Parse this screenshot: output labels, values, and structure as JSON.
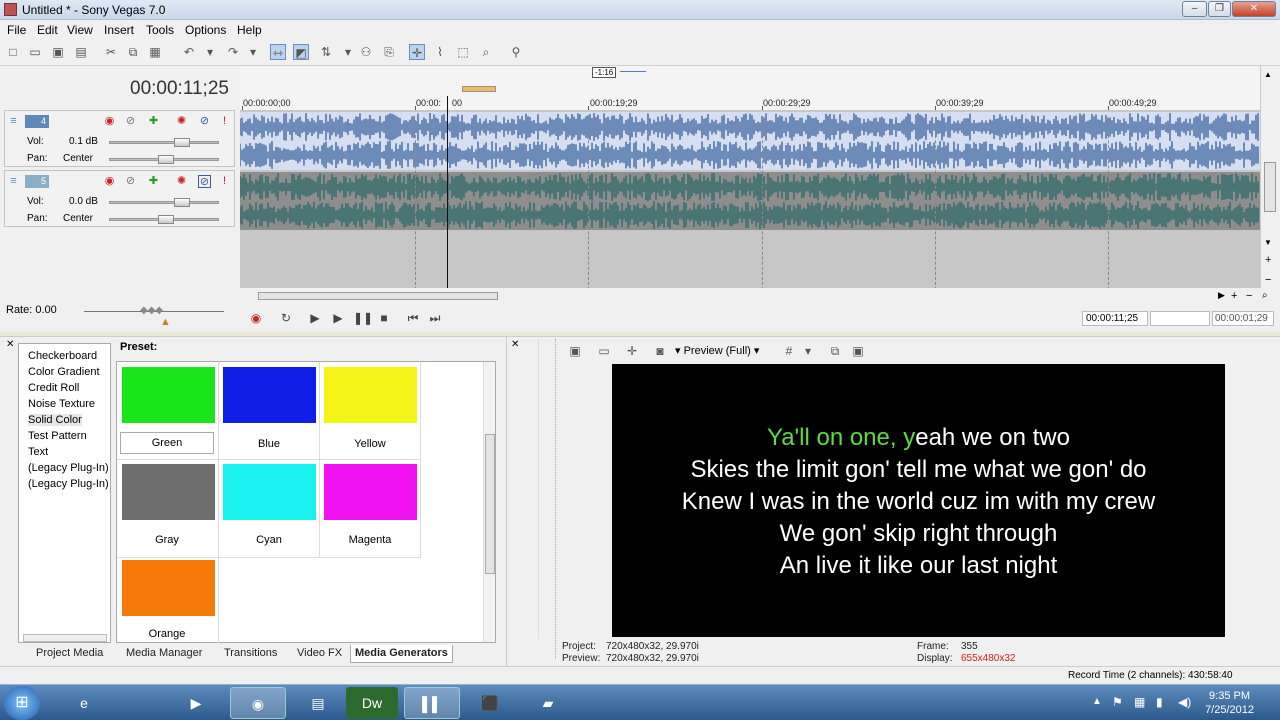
{
  "window": {
    "title": "Untitled * - Sony Vegas 7.0"
  },
  "menu": [
    "File",
    "Edit",
    "View",
    "Insert",
    "Tools",
    "Options",
    "Help"
  ],
  "timeline": {
    "cursor_time": "00:00:11;25",
    "loop_marker": "-1:16",
    "ruler_labels": [
      "00:00:00;00",
      "00:00:",
      "00",
      "00:00:19;29",
      "00:00:29;29",
      "00:00:39;29",
      "00:00:49;29"
    ],
    "tracks": [
      {
        "number": "4",
        "vol_label": "Vol:",
        "vol": "0.1 dB",
        "pan_label": "Pan:",
        "pan": "Center",
        "color": "#4a6fa5"
      },
      {
        "number": "5",
        "vol_label": "Vol:",
        "vol": "0.0 dB",
        "pan_label": "Pan:",
        "pan": "Center",
        "color": "#356b6b"
      }
    ]
  },
  "transport": {
    "rate": "Rate: 0.00",
    "time_current": "00:00:11;25",
    "time_length": "00:00:01;29"
  },
  "media_generators": {
    "list": [
      "Checkerboard",
      "Color Gradient",
      "Credit Roll",
      "Noise Texture",
      "Solid Color",
      "Test Pattern",
      "Text",
      "(Legacy Plug-In) T",
      "(Legacy Plug-In) V"
    ],
    "selected": "Solid Color",
    "preset_label": "Preset:",
    "presets": [
      {
        "name": "Green",
        "color": "#19e619"
      },
      {
        "name": "Blue",
        "color": "#0f1de6"
      },
      {
        "name": "Yellow",
        "color": "#f4f418"
      },
      {
        "name": "Gray",
        "color": "#6e6e6e"
      },
      {
        "name": "Cyan",
        "color": "#19f0f0"
      },
      {
        "name": "Magenta",
        "color": "#f012f0"
      },
      {
        "name": "Orange",
        "color": "#f57a0a"
      }
    ]
  },
  "tabs": [
    "Project Media",
    "Media Manager",
    "Transitions",
    "Video FX",
    "Media Generators"
  ],
  "preview": {
    "mode": "Preview (Full)",
    "lyrics": [
      {
        "hl": "Ya'll on one, y",
        "rest": "eah we on two"
      },
      {
        "hl": "",
        "rest": "Skies the limit gon' tell me what we gon' do"
      },
      {
        "hl": "",
        "rest": "Knew I was in the world cuz im with my crew"
      },
      {
        "hl": "",
        "rest": "We gon' skip right through"
      },
      {
        "hl": "",
        "rest": "An live it like our last night"
      }
    ],
    "project_label": "Project:",
    "project": "720x480x32, 29.970i",
    "preview_label": "Preview:",
    "preview_val": "720x480x32, 29.970i",
    "frame_label": "Frame:",
    "frame": "355",
    "display_label": "Display:",
    "display": "655x480x32"
  },
  "status": {
    "record_time": "Record Time (2 channels): 430:58:40"
  },
  "taskbar": {
    "time": "9:35 PM",
    "date": "7/25/2012",
    "dw_label": "Dw"
  }
}
